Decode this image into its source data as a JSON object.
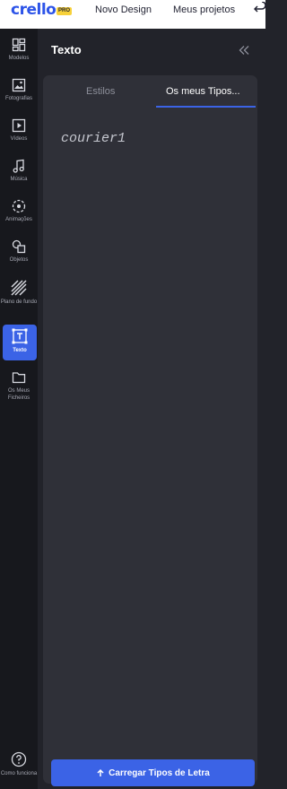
{
  "topbar": {
    "logo": "crello",
    "badge": "PRO",
    "nav": [
      "Novo Design",
      "Meus projetos"
    ]
  },
  "rail": {
    "items": [
      {
        "label": "Modelos",
        "icon": "templates-icon"
      },
      {
        "label": "Fotografias",
        "icon": "photos-icon"
      },
      {
        "label": "Vídeos",
        "icon": "video-icon"
      },
      {
        "label": "Música",
        "icon": "music-icon"
      },
      {
        "label": "Animações",
        "icon": "animations-icon"
      },
      {
        "label": "Objetos",
        "icon": "objects-icon"
      },
      {
        "label": "Plano de fundo",
        "icon": "background-icon"
      },
      {
        "label": "Texto",
        "icon": "text-icon"
      },
      {
        "label": "Os Meus Ficheiros",
        "icon": "folder-icon"
      }
    ],
    "active": "Texto",
    "help_label": "Como funciona"
  },
  "panel": {
    "title": "Texto",
    "tabs": [
      "Estilos",
      "Os meus Tipos..."
    ],
    "active_tab": "Os meus Tipos...",
    "fonts": [
      "courier1"
    ],
    "upload_label": "Carregar Tipos de Letra"
  },
  "colors": {
    "accent": "#3b63e6",
    "rail_bg": "#17181d",
    "panel_bg": "#22232a",
    "card_bg": "#2f3038",
    "pro_badge": "#f7d13a"
  }
}
